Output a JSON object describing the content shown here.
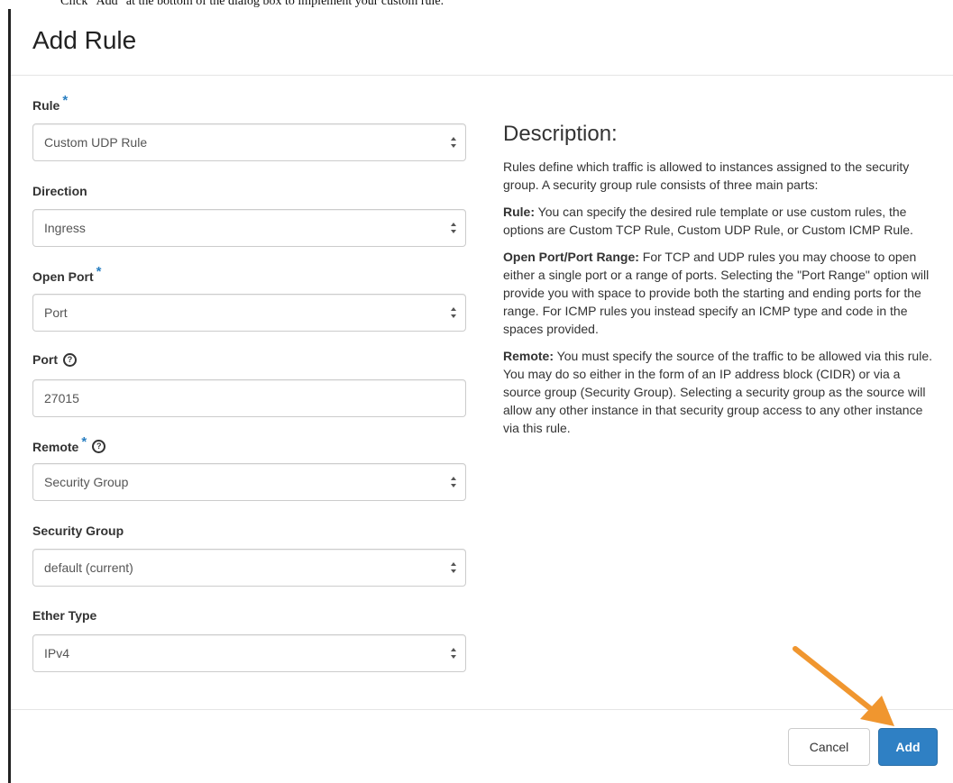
{
  "instruction": "Click \"Add\" at the bottom of the dialog box to implement your custom rule.",
  "dialog": {
    "title": "Add Rule",
    "fields": {
      "rule": {
        "label": "Rule",
        "value": "Custom UDP Rule"
      },
      "direction": {
        "label": "Direction",
        "value": "Ingress"
      },
      "open_port": {
        "label": "Open Port",
        "value": "Port"
      },
      "port": {
        "label": "Port",
        "value": "27015"
      },
      "remote": {
        "label": "Remote",
        "value": "Security Group"
      },
      "security_group": {
        "label": "Security Group",
        "value": "default (current)"
      },
      "ether_type": {
        "label": "Ether Type",
        "value": "IPv4"
      }
    },
    "description": {
      "heading": "Description:",
      "intro": "Rules define which traffic is allowed to instances assigned to the security group. A security group rule consists of three main parts:",
      "rule_title": "Rule:",
      "rule_text": "You can specify the desired rule template or use custom rules, the options are Custom TCP Rule, Custom UDP Rule, or Custom ICMP Rule.",
      "port_title": "Open Port/Port Range:",
      "port_text": "For TCP and UDP rules you may choose to open either a single port or a range of ports. Selecting the \"Port Range\" option will provide you with space to provide both the starting and ending ports for the range. For ICMP rules you instead specify an ICMP type and code in the spaces provided.",
      "remote_title": "Remote:",
      "remote_text": "You must specify the source of the traffic to be allowed via this rule. You may do so either in the form of an IP address block (CIDR) or via a source group (Security Group). Selecting a security group as the source will allow any other instance in that security group access to any other instance via this rule."
    },
    "buttons": {
      "cancel": "Cancel",
      "add": "Add"
    }
  },
  "colors": {
    "primary": "#2f80c4",
    "required": "#2a7fc1",
    "arrow": "#f0962f"
  },
  "icons": {
    "required": "asterisk",
    "help": "question-circle-icon",
    "caret": "up-down-caret-icon",
    "annotation": "orange-arrow"
  }
}
